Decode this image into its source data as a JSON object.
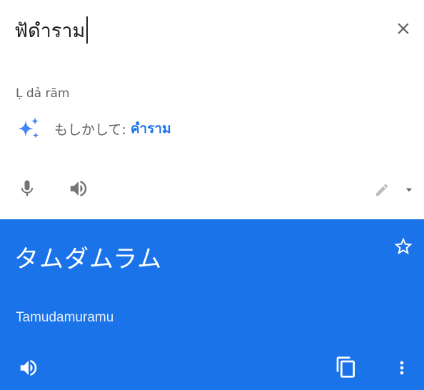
{
  "source": {
    "text": "ฟัดำราม",
    "transliteration": "Ḷ dả rām",
    "suggestion": {
      "label": "もしかして:",
      "corrected": "คำราม"
    },
    "icons": {
      "clear": "close-icon",
      "sparkle": "sparkle-icon",
      "mic": "microphone-icon",
      "speaker": "speaker-icon",
      "pen": "pencil-icon",
      "dropdown": "dropdown-arrow-icon"
    }
  },
  "translation": {
    "text": "タムダムラム",
    "romanization": "Tamudamuramu",
    "icons": {
      "star": "star-outline-icon",
      "speaker": "speaker-icon",
      "copy": "copy-icon",
      "more": "more-vert-icon"
    }
  },
  "colors": {
    "accent": "#1a73e8",
    "sparkle": "#4285f4",
    "icon_gray": "#757575",
    "text_dark": "#202124",
    "text_muted": "#5f6368"
  }
}
